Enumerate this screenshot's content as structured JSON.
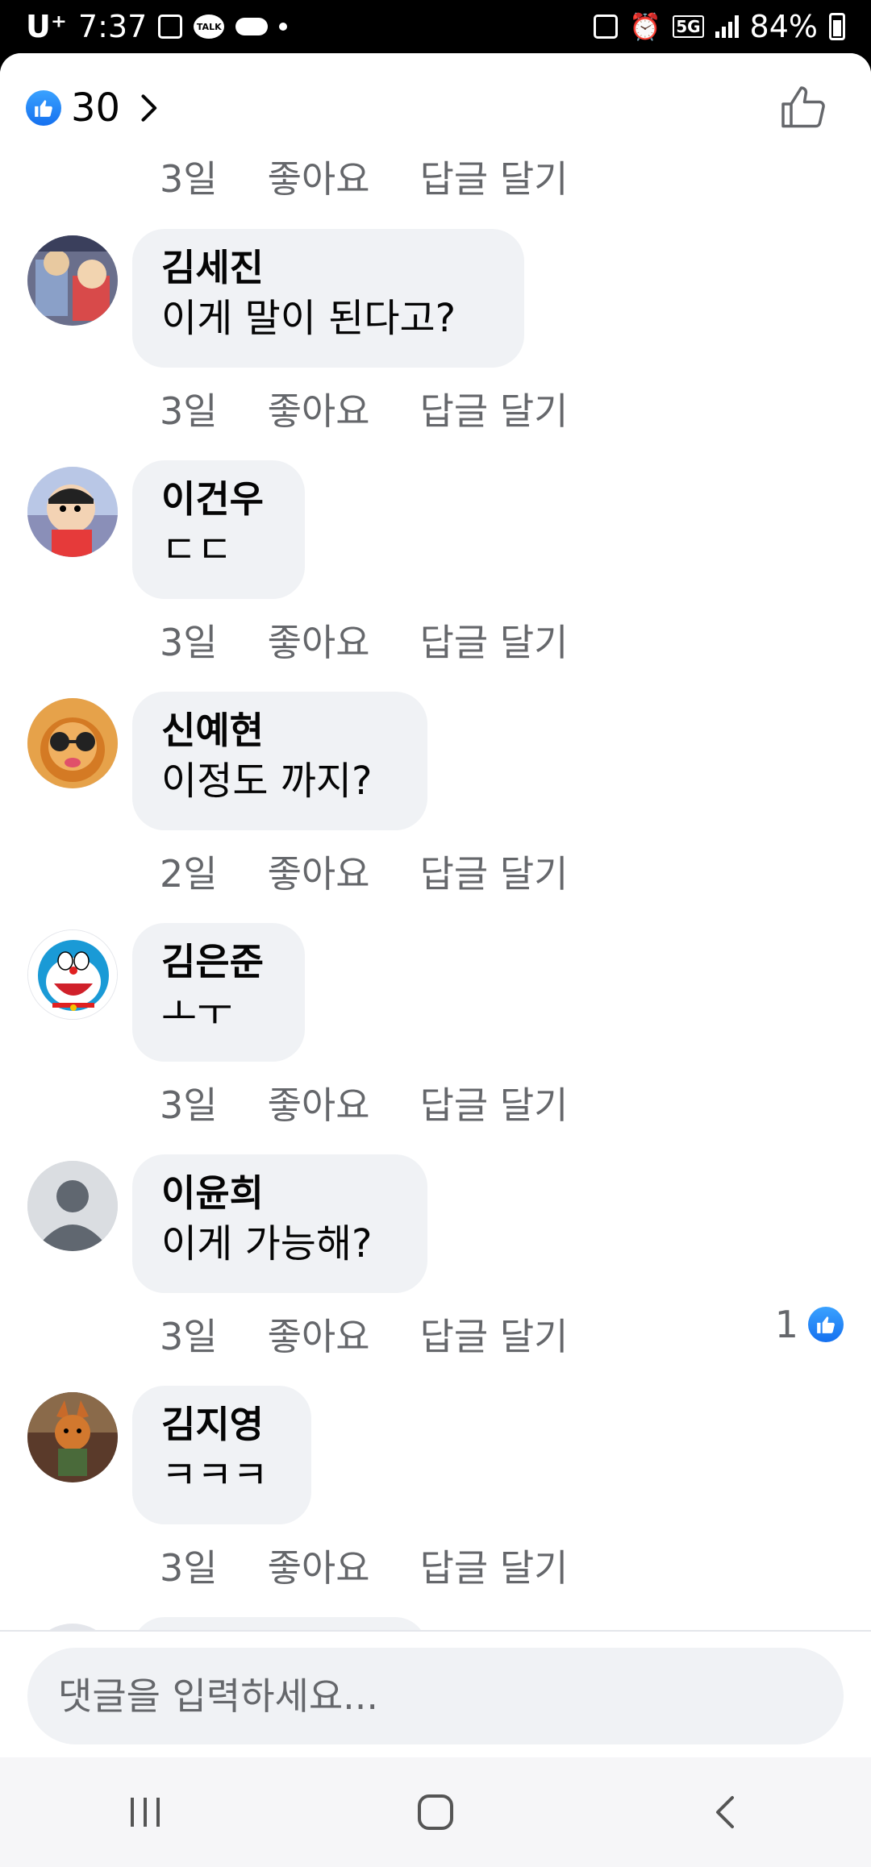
{
  "status_bar": {
    "carrier": "U⁺",
    "time": "7:37",
    "network": "5G",
    "battery": "84%"
  },
  "header": {
    "reaction_count": "30"
  },
  "comments": [
    {
      "author": "김세진",
      "text": "이게 말이 된다고?",
      "time": "3일",
      "like_label": "좋아요",
      "reply_label": "답글 달기",
      "avatar": "cartoon-couple",
      "likes": null
    },
    {
      "author": "이건우",
      "text": "ㄷㄷ",
      "time": "3일",
      "like_label": "좋아요",
      "reply_label": "답글 달기",
      "avatar": "crayon-shinchan",
      "likes": null
    },
    {
      "author": "신예현",
      "text": "이정도 까지?",
      "time": "2일",
      "like_label": "좋아요",
      "reply_label": "답글 달기",
      "avatar": "dog-sunglasses",
      "likes": null
    },
    {
      "author": "김은준",
      "text": "ㅗㅜ",
      "time": "3일",
      "like_label": "좋아요",
      "reply_label": "답글 달기",
      "avatar": "doraemon",
      "likes": null
    },
    {
      "author": "이윤희",
      "text": "이게 가능해?",
      "time": "3일",
      "like_label": "좋아요",
      "reply_label": "답글 달기",
      "avatar": "default-person",
      "likes": "1"
    },
    {
      "author": "김지영",
      "text": "ㅋㅋㅋ",
      "time": "3일",
      "like_label": "좋아요",
      "reply_label": "답글 달기",
      "avatar": "fox-character",
      "likes": null
    }
  ],
  "top_meta": {
    "time": "3일",
    "like_label": "좋아요",
    "reply_label": "답글 달기"
  },
  "composer": {
    "placeholder": "댓글을 입력하세요..."
  },
  "colors": {
    "accent": "#1877f2",
    "bubble": "#f0f2f5",
    "meta_text": "#65676b"
  }
}
